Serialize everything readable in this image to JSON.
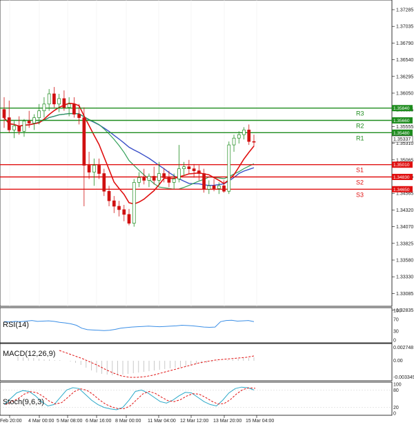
{
  "chart_data": {
    "type": "candlestick",
    "symbol_hint": "",
    "price_axis_ticks": [
      "1.37285",
      "1.37035",
      "1.36790",
      "1.36540",
      "1.36295",
      "1.36050",
      "1.35805",
      "1.35555",
      "1.35310",
      "1.35065",
      "1.34815",
      "1.34565",
      "1.34320",
      "1.34070",
      "1.33825",
      "1.33580",
      "1.33330",
      "1.33085",
      "1.32835"
    ],
    "price_range": [
      1.32835,
      1.37285
    ],
    "time_labels": [
      "Feb 20:00",
      "4 Mar 00:00",
      "5 Mar 08:00",
      "6 Mar 16:00",
      "8 Mar 00:00",
      "11 Mar 04:00",
      "12 Mar 12:00",
      "13 Mar 20:00",
      "15 Mar 04:00"
    ],
    "current_price": "1.35337",
    "levels": [
      {
        "name": "R3",
        "value": 1.3584,
        "tag": "1.35840",
        "color": "#1e8c1e"
      },
      {
        "name": "R2",
        "value": 1.3566,
        "tag": "1.35660",
        "color": "#1e8c1e"
      },
      {
        "name": "R1",
        "value": 1.3548,
        "tag": "1.35480",
        "color": "#1e8c1e"
      },
      {
        "name": "S1",
        "value": 1.3501,
        "tag": "1.35010",
        "color": "#e01010"
      },
      {
        "name": "S2",
        "value": 1.3483,
        "tag": "1.34830",
        "color": "#e01010"
      },
      {
        "name": "S3",
        "value": 1.3465,
        "tag": "1.34650",
        "color": "#e01010"
      }
    ],
    "candles": [
      [
        1.3582,
        1.36,
        1.3555,
        1.357
      ],
      [
        1.357,
        1.3595,
        1.3548,
        1.3552
      ],
      [
        1.3552,
        1.3565,
        1.354,
        1.3558
      ],
      [
        1.3558,
        1.3572,
        1.3545,
        1.355
      ],
      [
        1.355,
        1.3568,
        1.3542,
        1.3565
      ],
      [
        1.3565,
        1.358,
        1.3555,
        1.3562
      ],
      [
        1.3562,
        1.3575,
        1.3552,
        1.357
      ],
      [
        1.357,
        1.359,
        1.356,
        1.358
      ],
      [
        1.358,
        1.36,
        1.357,
        1.359
      ],
      [
        1.359,
        1.3612,
        1.358,
        1.3605
      ],
      [
        1.3605,
        1.3615,
        1.3585,
        1.359
      ],
      [
        1.359,
        1.3605,
        1.3578,
        1.3598
      ],
      [
        1.3598,
        1.361,
        1.358,
        1.3585
      ],
      [
        1.3585,
        1.36,
        1.3572,
        1.359
      ],
      [
        1.359,
        1.36,
        1.357,
        1.3575
      ],
      [
        1.3575,
        1.359,
        1.356,
        1.357
      ],
      [
        1.357,
        1.3585,
        1.344,
        1.35
      ],
      [
        1.35,
        1.352,
        1.348,
        1.349
      ],
      [
        1.349,
        1.351,
        1.347,
        1.35
      ],
      [
        1.35,
        1.351,
        1.348,
        1.3488
      ],
      [
        1.3488,
        1.3495,
        1.3455,
        1.3462
      ],
      [
        1.3462,
        1.347,
        1.344,
        1.3448
      ],
      [
        1.3448,
        1.3455,
        1.343,
        1.344
      ],
      [
        1.344,
        1.3448,
        1.3425,
        1.3435
      ],
      [
        1.3435,
        1.3442,
        1.3418,
        1.3428
      ],
      [
        1.3428,
        1.3436,
        1.3412,
        1.3415
      ],
      [
        1.3415,
        1.348,
        1.341,
        1.3475
      ],
      [
        1.3475,
        1.349,
        1.3468,
        1.3482
      ],
      [
        1.3482,
        1.3495,
        1.3472,
        1.3478
      ],
      [
        1.3478,
        1.3488,
        1.3468,
        1.3484
      ],
      [
        1.3484,
        1.3498,
        1.3472,
        1.3478
      ],
      [
        1.3478,
        1.3505,
        1.347,
        1.3488
      ],
      [
        1.3488,
        1.3496,
        1.3475,
        1.3482
      ],
      [
        1.3482,
        1.3492,
        1.3468,
        1.3475
      ],
      [
        1.3475,
        1.3488,
        1.3465,
        1.348
      ],
      [
        1.348,
        1.353,
        1.3475,
        1.3495
      ],
      [
        1.3495,
        1.3505,
        1.3485,
        1.3498
      ],
      [
        1.3498,
        1.3508,
        1.3488,
        1.3495
      ],
      [
        1.3495,
        1.3502,
        1.3482,
        1.3492
      ],
      [
        1.3492,
        1.35,
        1.3478,
        1.3488
      ],
      [
        1.3488,
        1.3495,
        1.346,
        1.3465
      ],
      [
        1.3465,
        1.3478,
        1.3458,
        1.347
      ],
      [
        1.347,
        1.348,
        1.3462,
        1.3466
      ],
      [
        1.3466,
        1.3475,
        1.3458,
        1.347
      ],
      [
        1.347,
        1.3478,
        1.346,
        1.3462
      ],
      [
        1.3462,
        1.3535,
        1.3458,
        1.353
      ],
      [
        1.353,
        1.3545,
        1.352,
        1.354
      ],
      [
        1.354,
        1.355,
        1.3532,
        1.3545
      ],
      [
        1.3545,
        1.3556,
        1.3538,
        1.3552
      ],
      [
        1.3552,
        1.356,
        1.353,
        1.3535
      ],
      [
        1.3535,
        1.3545,
        1.3528,
        1.3534
      ]
    ],
    "panels": [
      {
        "name": "RSI(14)",
        "ticks": [
          "100",
          "70",
          "30",
          "0"
        ]
      },
      {
        "name": "MACD(12,26,9)",
        "ticks": [
          "0.002748",
          "0.00",
          "-0.003349"
        ]
      },
      {
        "name": "Stoch(9,6,3)",
        "ticks": [
          "100",
          "80",
          "20",
          "0"
        ]
      }
    ]
  }
}
